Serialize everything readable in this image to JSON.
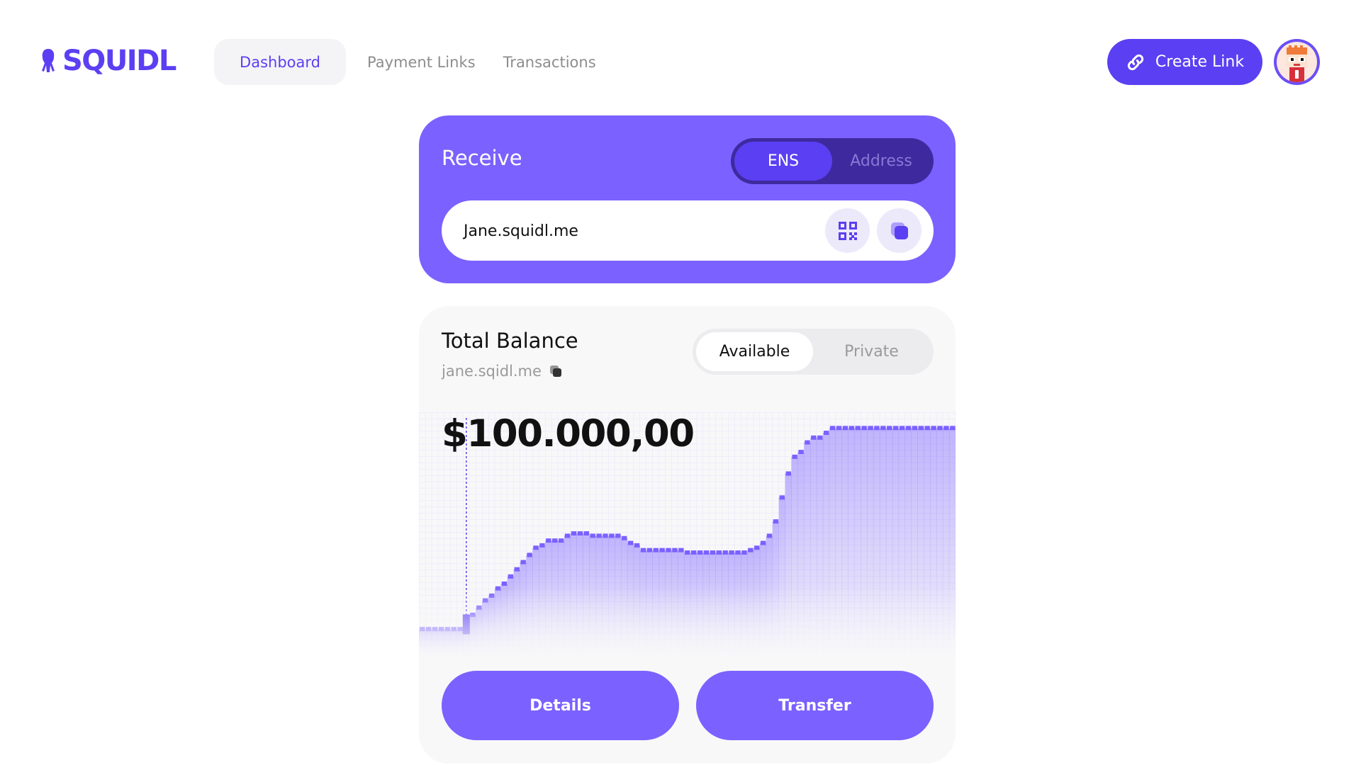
{
  "brand": {
    "name": "SQUIDL",
    "accent": "#5b3ff2",
    "card": "#7b61ff"
  },
  "nav": {
    "items": [
      {
        "label": "Dashboard",
        "active": true
      },
      {
        "label": "Payment Links",
        "active": false
      },
      {
        "label": "Transactions",
        "active": false
      }
    ]
  },
  "header": {
    "create_label": "Create Link",
    "create_icon": "link-icon",
    "avatar_icon": "pixel-avatar"
  },
  "receive": {
    "title": "Receive",
    "toggle": {
      "options": [
        "ENS",
        "Address"
      ],
      "selected": "ENS"
    },
    "value": "Jane.squidl.me",
    "icons": [
      "qr-code-icon",
      "copy-icon"
    ]
  },
  "balance": {
    "title": "Total Balance",
    "ens": "jane.sqidl.me",
    "toggle": {
      "options": [
        "Available",
        "Private"
      ],
      "selected": "Available"
    },
    "amount": "$100.000,00",
    "actions": {
      "details": "Details",
      "transfer": "Transfer"
    }
  },
  "chart_data": {
    "type": "area",
    "x": [
      0,
      1,
      2,
      3,
      4,
      5,
      6,
      7,
      8,
      9,
      10,
      11,
      12,
      13,
      14,
      15,
      16,
      17,
      18,
      19,
      20,
      21,
      22,
      23,
      24,
      25,
      26,
      27,
      28,
      29,
      30,
      31,
      32,
      33,
      34,
      35,
      36,
      37,
      38,
      39,
      40,
      41,
      42,
      43,
      44,
      45,
      46,
      47,
      48,
      49,
      50,
      51,
      52,
      53,
      54,
      55,
      56,
      57,
      58,
      59,
      60,
      61,
      62,
      63,
      64,
      65,
      66,
      67,
      68,
      69,
      70,
      71,
      72,
      73,
      74,
      75,
      76,
      77,
      78,
      79,
      80,
      81,
      82,
      83,
      84
    ],
    "values": [
      10,
      10,
      10,
      10,
      10,
      10,
      10,
      12,
      16,
      19,
      22,
      24,
      27,
      29,
      32,
      35,
      38,
      41,
      44,
      45,
      47,
      47,
      47,
      49,
      50,
      50,
      50,
      49,
      49,
      49,
      49,
      49,
      48,
      46,
      45,
      43,
      43,
      43,
      43,
      43,
      43,
      43,
      42,
      42,
      42,
      42,
      42,
      42,
      42,
      42,
      42,
      42,
      43,
      44,
      46,
      49,
      55,
      65,
      75,
      82,
      84,
      88,
      90,
      90,
      92,
      94,
      94,
      94,
      94,
      94,
      94,
      94,
      94,
      94,
      94,
      94,
      94,
      94,
      94,
      94,
      94,
      94,
      94,
      94,
      94
    ],
    "ylim": [
      0,
      100
    ],
    "highlight_index": 7,
    "color": "#7b61ff",
    "grid": true
  }
}
